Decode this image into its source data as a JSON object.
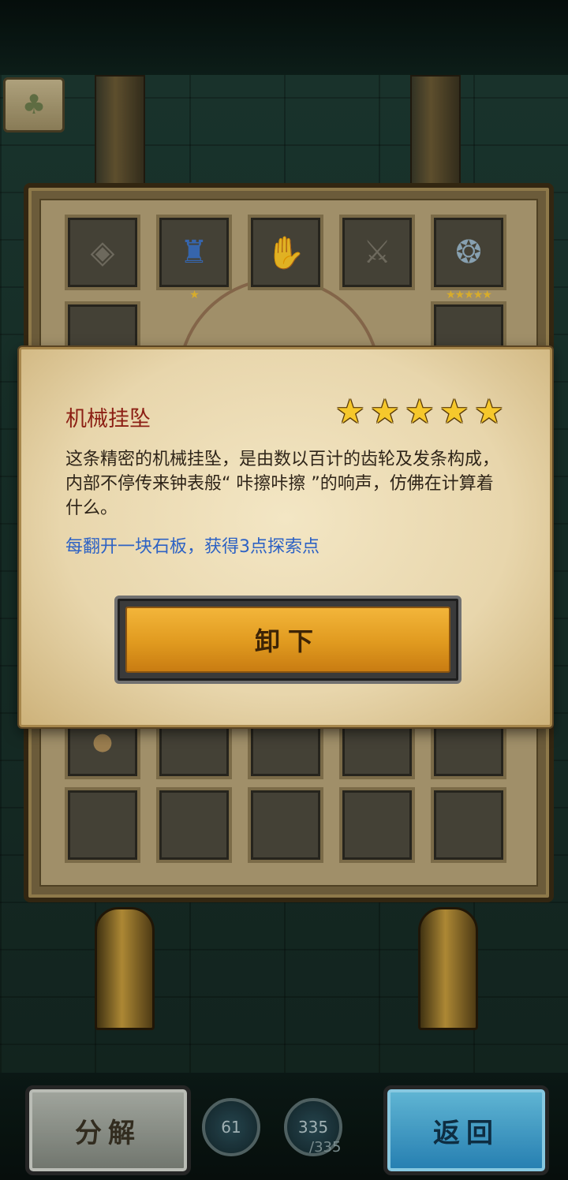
{
  "background": {
    "clover_icon": "clover-icon"
  },
  "item": {
    "name": "机械挂坠",
    "rating": 5,
    "description": "这条精密的机械挂坠，是由数以百计的齿轮及发条构成，内部不停传来钟表般“ 咔擦咔擦 ”的响声，仿佛在计算着什么。",
    "effect": "每翻开一块石板，获得3点探索点"
  },
  "buttons": {
    "unequip": "卸下",
    "decompose": "分解",
    "back": "返回"
  },
  "gauges": {
    "left_value": "61",
    "right_value": "335",
    "right_max": "/335"
  },
  "colors": {
    "title_red": "#8c1f14",
    "effect_blue": "#2d62c4",
    "star_gold": "#f6c82c",
    "unequip_orange": "#e09a1f",
    "back_blue": "#2a8fc9"
  }
}
